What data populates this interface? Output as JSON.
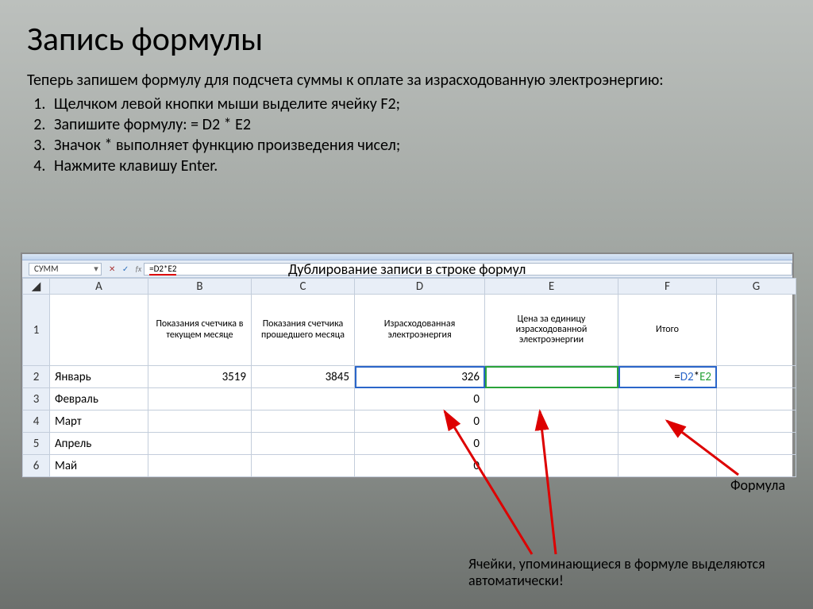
{
  "title": "Запись формулы",
  "intro": "Теперь запишем формулу для подсчета суммы к оплате за израсходованную электроэнергию:",
  "steps": [
    "Щелчком левой кнопки мыши выделите ячейку F2;",
    "Запишите формулу: = D2 * E2",
    "Значок * выполняет функцию произведения чисел;",
    "Нажмите клавишу Enter."
  ],
  "formula_bar": {
    "namebox": "СУММ",
    "formula": "=D2*E2"
  },
  "dup_note": "Дублирование записи в строке формул",
  "columns": [
    "A",
    "B",
    "C",
    "D",
    "E",
    "F",
    "G"
  ],
  "headers": {
    "A": "",
    "B": "Показания счетчика в текущем месяце",
    "C": "Показания счетчика прошедшего месяца",
    "D": "Израсходованная электроэнергия",
    "E": "Цена за единицу израсходованной электроэнергии",
    "F": "Итого",
    "G": ""
  },
  "rows": [
    {
      "n": "2",
      "month": "Январь",
      "b": "3519",
      "c": "3845",
      "d": "326",
      "e": "",
      "f": "=D2*E2"
    },
    {
      "n": "3",
      "month": "Февраль",
      "b": "",
      "c": "",
      "d": "0",
      "e": "",
      "f": ""
    },
    {
      "n": "4",
      "month": "Март",
      "b": "",
      "c": "",
      "d": "0",
      "e": "",
      "f": ""
    },
    {
      "n": "5",
      "month": "Апрель",
      "b": "",
      "c": "",
      "d": "0",
      "e": "",
      "f": ""
    },
    {
      "n": "6",
      "month": "Май",
      "b": "",
      "c": "",
      "d": "0",
      "e": "",
      "f": ""
    }
  ],
  "annot_formula": "Формула",
  "annot_cells": "Ячейки, упоминающиеся в формуле выделяются автоматически!"
}
